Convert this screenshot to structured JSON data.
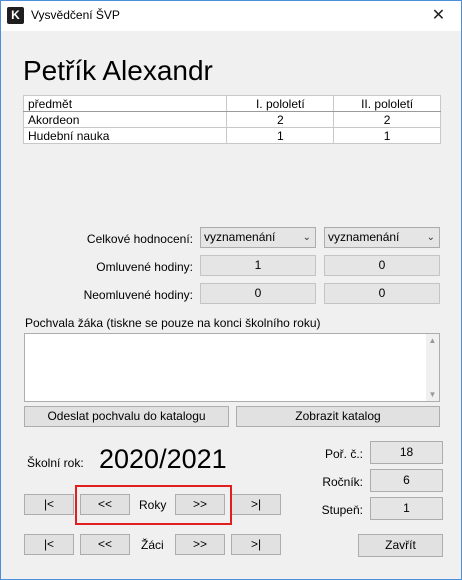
{
  "window": {
    "title": "Vysvědčení ŠVP",
    "close_glyph": "✕",
    "app_icon_letter": "K"
  },
  "student": {
    "name": "Petřík Alexandr"
  },
  "grades_table": {
    "headers": [
      "předmět",
      "I. pololetí",
      "II. pololetí"
    ],
    "rows": [
      {
        "subject": "Akordeon",
        "h1": "2",
        "h2": "2"
      },
      {
        "subject": "Hudební nauka",
        "h1": "1",
        "h2": "1"
      }
    ]
  },
  "evaluation": {
    "overall_label": "Celkové hodnocení:",
    "overall_h1": "vyznamenání",
    "overall_h2": "vyznamenání",
    "excused_label": "Omluvené hodiny:",
    "excused_h1": "1",
    "excused_h2": "0",
    "unexcused_label": "Neomluvené hodiny:",
    "unexcused_h1": "0",
    "unexcused_h2": "0"
  },
  "praise": {
    "label": "Pochvala žáka (tiskne se pouze na konci školního roku)",
    "value": "",
    "send_button": "Odeslat pochvalu do katalogu",
    "catalog_button": "Zobrazit katalog"
  },
  "school_year": {
    "label": "Školní rok:",
    "value": "2020/2021"
  },
  "nav_years": {
    "first": "|<",
    "prev": "<<",
    "label": "Roky",
    "next": ">>",
    "last": ">|"
  },
  "nav_students": {
    "first": "|<",
    "prev": "<<",
    "label": "Žáci",
    "next": ">>",
    "last": ">|"
  },
  "info": {
    "order_label": "Poř. č.:",
    "order_value": "18",
    "grade_label": "Ročník:",
    "grade_value": "6",
    "level_label": "Stupeň:",
    "level_value": "1"
  },
  "close_button": "Zavřít",
  "colors": {
    "highlight": "#e02020",
    "window_bg": "#f0f0f0",
    "border_accent": "#4a8fd8"
  }
}
